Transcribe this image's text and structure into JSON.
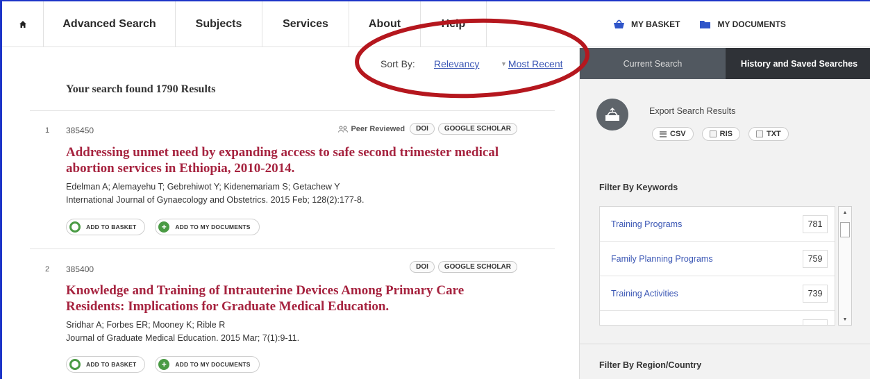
{
  "nav": {
    "items": [
      "Advanced Search",
      "Subjects",
      "Services",
      "About",
      "Help"
    ],
    "basket": "MY BASKET",
    "documents": "MY DOCUMENTS"
  },
  "sort": {
    "label": "Sort By:",
    "relevancy": "Relevancy",
    "most_recent": "Most Recent"
  },
  "summary": "Your search found 1790 Results",
  "results": [
    {
      "num": "1",
      "id": "385450",
      "peer_reviewed": "Peer Reviewed",
      "doi": "DOI",
      "scholar": "GOOGLE SCHOLAR",
      "title": "Addressing unmet need by expanding access to safe second trimester medical abortion services in Ethiopia, 2010-2014.",
      "authors": "Edelman A; Alemayehu T; Gebrehiwot Y; Kidenemariam S; Getachew Y",
      "journal": "International Journal of Gynaecology and Obstetrics. 2015 Feb; 128(2):177-8.",
      "add_basket": "ADD TO BASKET",
      "add_docs": "ADD TO MY DOCUMENTS"
    },
    {
      "num": "2",
      "id": "385400",
      "doi": "DOI",
      "scholar": "GOOGLE SCHOLAR",
      "title": "Knowledge and Training of Intrauterine Devices Among Primary Care Residents: Implications for Graduate Medical Education.",
      "authors": "Sridhar A; Forbes ER; Mooney K; Rible R",
      "journal": "Journal of Graduate Medical Education. 2015 Mar; 7(1):9-11.",
      "add_basket": "ADD TO BASKET",
      "add_docs": "ADD TO MY DOCUMENTS"
    }
  ],
  "panel": {
    "tab_current": "Current Search",
    "tab_history": "History and Saved Searches",
    "export_title": "Export Search Results",
    "export": [
      "CSV",
      "RIS",
      "TXT"
    ],
    "keywords_title": "Filter By Keywords",
    "keywords": [
      {
        "label": "Training Programs",
        "count": "781"
      },
      {
        "label": "Family Planning Programs",
        "count": "759"
      },
      {
        "label": "Training Activities",
        "count": "739"
      }
    ],
    "region_title": "Filter By Region/Country"
  },
  "colors": {
    "title_red": "#a6233f",
    "link_blue": "#3a56b4",
    "annotation_red": "#b5171e",
    "green": "#4a9b44"
  }
}
